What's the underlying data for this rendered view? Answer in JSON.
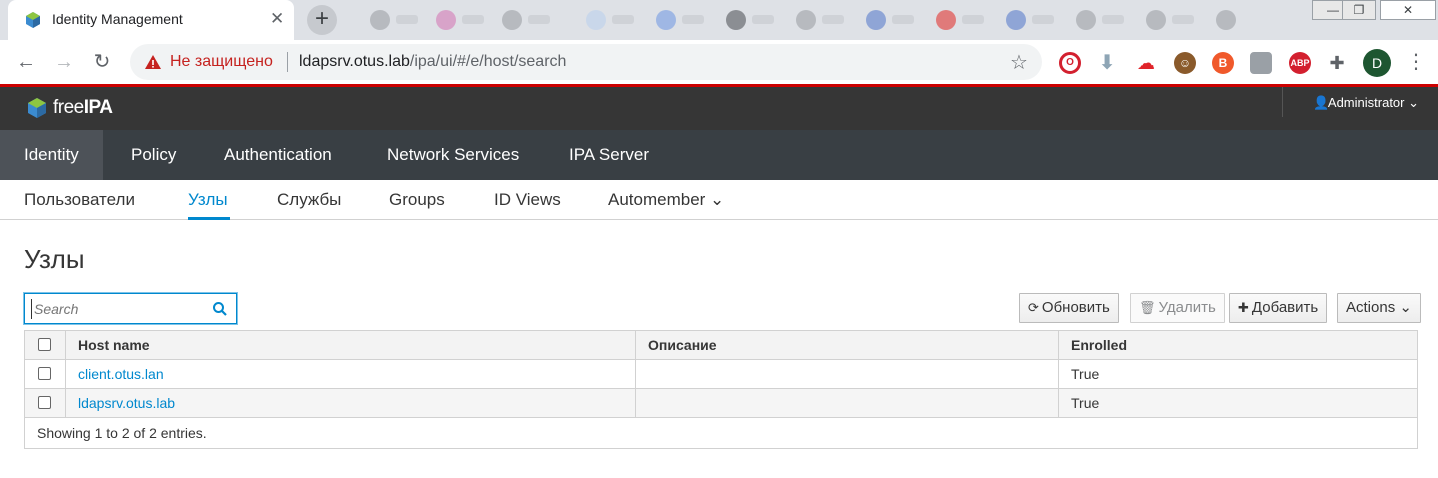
{
  "browser": {
    "tab_title": "Identity Management",
    "tab_close": "✕",
    "new_tab": "+",
    "insecure_label": "Не защищено",
    "url_host": "ldapsrv.otus.lab",
    "url_path": "/ipa/ui/#/e/host/search",
    "profile_initial": "D",
    "extensions": [
      "opera-icon",
      "download-icon",
      "cloud-icon",
      "avatar-icon",
      "brave-icon",
      "hat-icon",
      "abp-icon",
      "puzzle-icon"
    ],
    "abp_label": "ABP"
  },
  "app": {
    "brand_light": "free",
    "brand_bold": "IPA",
    "user": "Administrator",
    "user_caret": "⌄"
  },
  "primary_nav": [
    {
      "label": "Identity",
      "active": true
    },
    {
      "label": "Policy"
    },
    {
      "label": "Authentication"
    },
    {
      "label": "Network Services"
    },
    {
      "label": "IPA Server"
    }
  ],
  "secondary_nav": [
    {
      "label": "Пользователи"
    },
    {
      "label": "Узлы",
      "active": true
    },
    {
      "label": "Службы"
    },
    {
      "label": "Groups"
    },
    {
      "label": "ID Views"
    },
    {
      "label": "Automember ⌄"
    }
  ],
  "page": {
    "title": "Узлы",
    "search_placeholder": "Search"
  },
  "actions": {
    "refresh": "Обновить",
    "delete": "Удалить",
    "add": "Добавить",
    "actions": "Actions ⌄"
  },
  "table": {
    "columns": [
      "Host name",
      "Описание",
      "Enrolled"
    ],
    "rows": [
      {
        "host": "client.otus.lan",
        "description": "",
        "enrolled": "True"
      },
      {
        "host": "ldapsrv.otus.lab",
        "description": "",
        "enrolled": "True"
      }
    ],
    "footer": "Showing 1 to 2 of 2 entries."
  },
  "colors": {
    "accent": "#0088ce",
    "masthead": "#363636",
    "primary_nav": "#393f44",
    "primary_nav_active": "#4d5258",
    "insecure": "#c5221f"
  }
}
